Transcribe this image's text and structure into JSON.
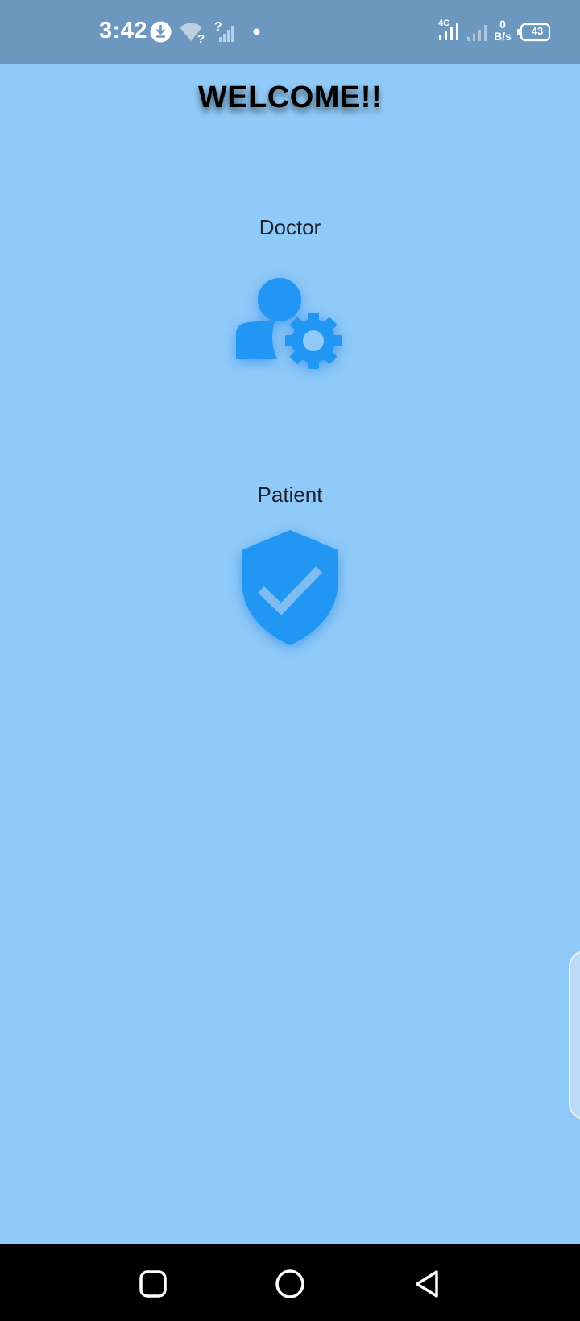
{
  "status_bar": {
    "time": "3:42",
    "network_type": "4G",
    "net_speed_value": "0",
    "net_speed_unit": "B/s",
    "battery_level": "43",
    "icons": [
      "download-icon",
      "wifi-unknown-icon",
      "signal-unknown-icon",
      "notification-dot-icon",
      "signal-4g-icon",
      "signal-2-icon",
      "battery-icon"
    ]
  },
  "main": {
    "title": "WELCOME!!",
    "roles": [
      {
        "label": "Doctor",
        "icon": "user-gear-icon"
      },
      {
        "label": "Patient",
        "icon": "shield-check-icon"
      }
    ]
  },
  "nav_bar": {
    "buttons": [
      "recents-button",
      "home-button",
      "back-button"
    ]
  },
  "colors": {
    "background": "#90caf8",
    "status_bar": "#6c98bf",
    "icon_accent": "#2196f3",
    "title": "#000000",
    "nav_bar": "#000000"
  }
}
